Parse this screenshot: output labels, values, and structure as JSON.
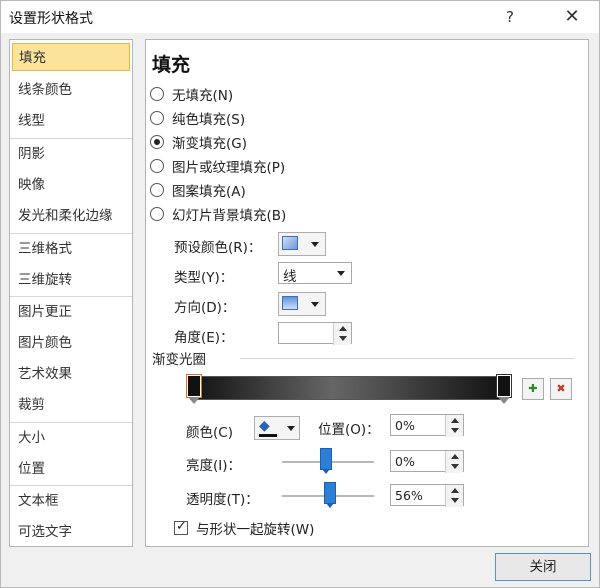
{
  "window": {
    "title": "设置形状格式",
    "help": "?",
    "close": "✕"
  },
  "sidebar": {
    "items": [
      {
        "label": "填充",
        "selected": true
      },
      {
        "label": "线条颜色"
      },
      {
        "label": "线型"
      },
      {
        "label": "阴影"
      },
      {
        "label": "映像"
      },
      {
        "label": "发光和柔化边缘"
      },
      {
        "label": "三维格式"
      },
      {
        "label": "三维旋转"
      },
      {
        "label": "图片更正"
      },
      {
        "label": "图片颜色"
      },
      {
        "label": "艺术效果"
      },
      {
        "label": "裁剪"
      },
      {
        "label": "大小"
      },
      {
        "label": "位置"
      },
      {
        "label": "文本框"
      },
      {
        "label": "可选文字"
      }
    ]
  },
  "panel": {
    "heading": "填充",
    "fill_options": [
      {
        "label": "无填充(N)",
        "selected": false
      },
      {
        "label": "纯色填充(S)",
        "selected": false
      },
      {
        "label": "渐变填充(G)",
        "selected": true
      },
      {
        "label": "图片或纹理填充(P)",
        "selected": false
      },
      {
        "label": "图案填充(A)",
        "selected": false
      },
      {
        "label": "幻灯片背景填充(B)",
        "selected": false
      }
    ],
    "preset_label": "预设颜色(R)：",
    "type_label": "类型(Y)：",
    "type_value": "线",
    "direction_label": "方向(D)：",
    "angle_label": "角度(E)：",
    "gradient_label": "渐变光圈",
    "color_label": "颜色(C)",
    "position_label": "位置(O)：",
    "position_value": "0%",
    "brightness_label": "亮度(I)：",
    "brightness_value": "0%",
    "transparency_label": "透明度(T)：",
    "transparency_value": "56%",
    "rotate_label": "与形状一起旋转(W)"
  },
  "footer": {
    "close_label": "关闭"
  },
  "colors": {
    "selected_bg": "#fbe39a",
    "accent": "#2e7dd7"
  }
}
